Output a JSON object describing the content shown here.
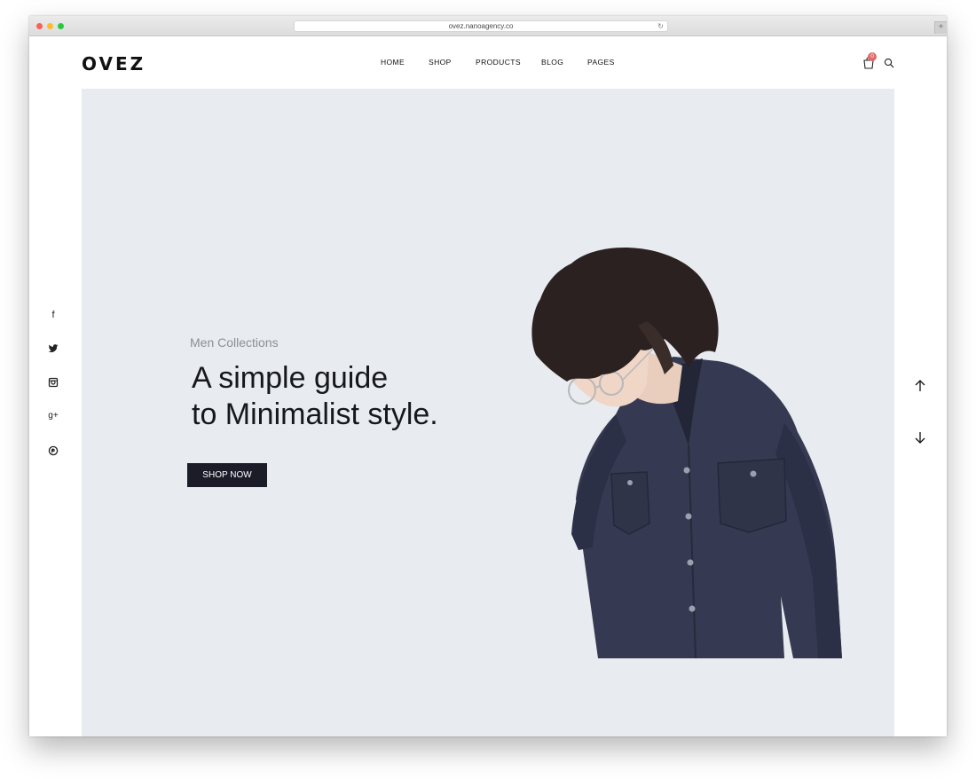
{
  "browser": {
    "url": "ovez.nanoagency.co",
    "new_tab": "+"
  },
  "header": {
    "logo": "OVEZ",
    "nav": [
      "HOME",
      "SHOP",
      "PRODUCTS",
      "BLOG",
      "PAGES"
    ],
    "cart_count": "0",
    "icons": [
      "cart-icon",
      "search-icon"
    ]
  },
  "hero": {
    "subtitle": "Men Collections",
    "title_line1": "A simple guide",
    "title_line2": "to Minimalist style.",
    "button": "SHOP NOW"
  },
  "social": {
    "facebook": "f",
    "twitter": "twitter-icon",
    "instagram": "instagram-icon",
    "google_plus": "g+",
    "pinterest": "pinterest-icon"
  },
  "slider": {
    "icons": [
      "arrow-up-icon",
      "arrow-down-icon"
    ]
  },
  "colors": {
    "hero_bg": "#e8ebf0",
    "button_bg": "#1b1c28",
    "badge": "#e26a6a",
    "shirt": "#353a52"
  }
}
